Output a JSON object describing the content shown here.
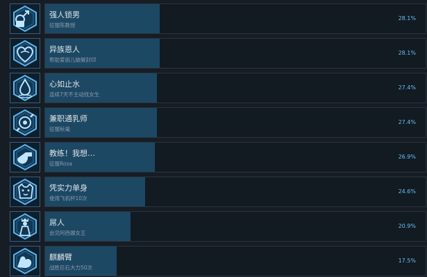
{
  "achievements": [
    {
      "title": "强人锁男",
      "description": "征服陈教授",
      "percent_label": "28.1%",
      "percent": 28.1,
      "icon": "lock-gender-icon"
    },
    {
      "title": "异族恩人",
      "description": "帮助爱丽儿破解封印",
      "percent_label": "28.1%",
      "percent": 28.1,
      "icon": "heart-icon"
    },
    {
      "title": "心如止水",
      "description": "连续7天不主动找女生",
      "percent_label": "27.4%",
      "percent": 27.4,
      "icon": "water-drop-icon"
    },
    {
      "title": "兼职通乳师",
      "description": "征服秋毫",
      "percent_label": "27.4%",
      "percent": 27.4,
      "icon": "pacifier-icon"
    },
    {
      "title": "教练！我想…",
      "description": "征服Rosa",
      "percent_label": "26.9%",
      "percent": 26.9,
      "icon": "whistle-icon"
    },
    {
      "title": "凭实力单身",
      "description": "使用飞机杯10次",
      "percent_label": "24.6%",
      "percent": 24.6,
      "icon": "dog-icon"
    },
    {
      "title": "屌人",
      "description": "会见阿西娜女王",
      "percent_label": "20.9%",
      "percent": 20.9,
      "icon": "queen-figure-icon"
    },
    {
      "title": "麒麟臂",
      "description": "战胜巨石大力50次",
      "percent_label": "17.5%",
      "percent": 17.5,
      "icon": "flexed-arm-icon"
    }
  ],
  "colors": {
    "background": "#171d25",
    "bar_fill": "#1d4864",
    "percent_text": "#66c0f4",
    "icon_glow": "#5fb4e8"
  }
}
